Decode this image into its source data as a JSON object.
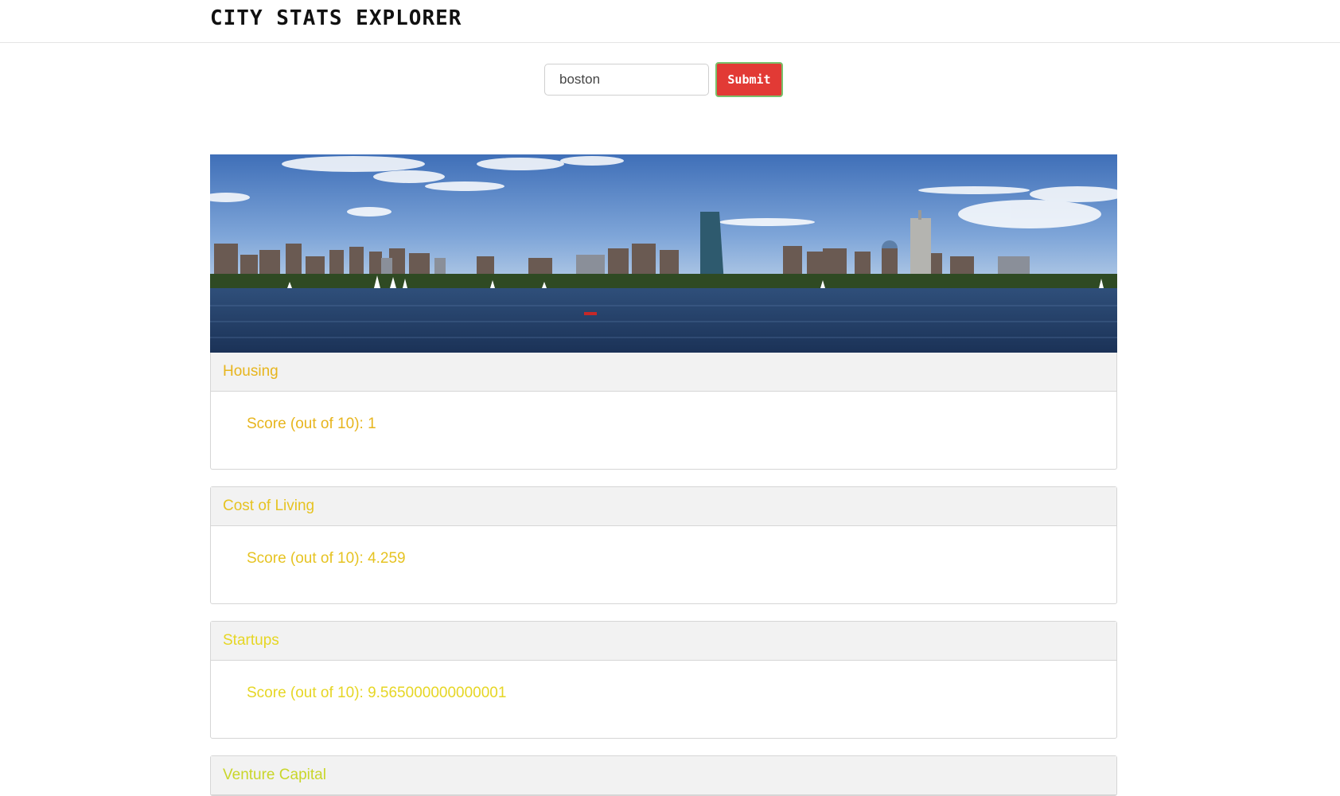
{
  "app": {
    "title": "CITY STATS EXPLORER"
  },
  "search": {
    "value": "boston",
    "submit_label": "Submit"
  },
  "hero": {
    "icon": "city-skyline-photo"
  },
  "panels": [
    {
      "title": "Housing",
      "score_text": "Score (out of 10): 1",
      "color": "#e7b51d"
    },
    {
      "title": "Cost of Living",
      "score_text": "Score (out of 10): 4.259",
      "color": "#e6c322"
    },
    {
      "title": "Startups",
      "score_text": "Score (out of 10): 9.565000000000001",
      "color": "#e6d624"
    },
    {
      "title": "Venture Capital",
      "color": "#c9d62a"
    }
  ]
}
